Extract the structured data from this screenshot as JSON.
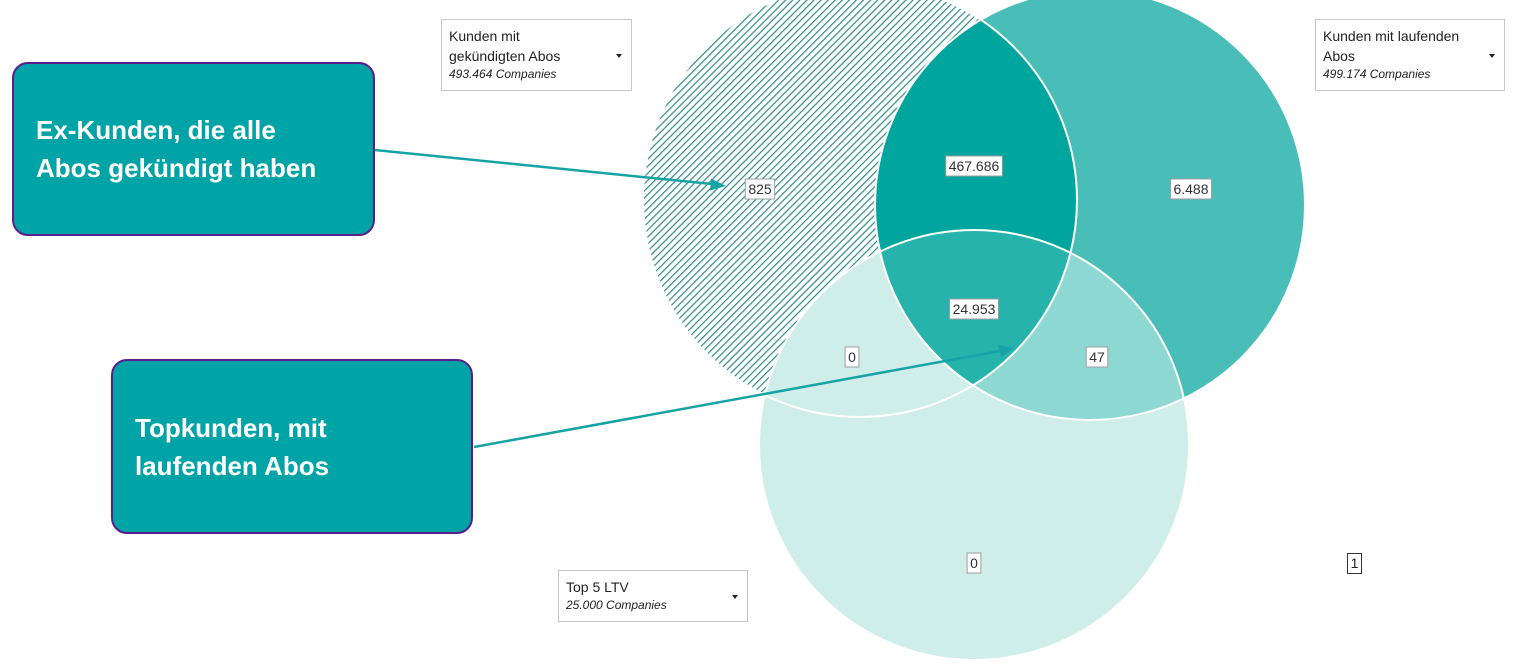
{
  "colors": {
    "set_a": "#49beb8",
    "set_b": "#49beb8",
    "set_c": "#cfede9",
    "ab": "#00a59e",
    "bc": "#8ed8d3",
    "abc": "#26b3ac",
    "ac": "#cfede9",
    "hatch_bg": "#ffffff",
    "hatch_line": "#2f8c85",
    "callout_fill": "#00a3a6",
    "callout_border": "#5a1e8c",
    "arrow": "#16a3a6"
  },
  "sets": [
    {
      "id": "a",
      "title": "Kunden mit gekündigten Abos",
      "title_lines": [
        "Kunden mit",
        "gekündigten Abos"
      ],
      "count": "493.464 Companies"
    },
    {
      "id": "b",
      "title": "Kunden mit laufenden Abos",
      "title_lines": [
        "Kunden mit laufenden",
        "Abos"
      ],
      "count": "499.174 Companies"
    },
    {
      "id": "c",
      "title": "Top 5 LTV",
      "title_lines": [
        "Top 5 LTV"
      ],
      "count": "25.000 Companies"
    }
  ],
  "regions": {
    "a_only": "825",
    "b_only": "6.488",
    "c_only": "0",
    "ab": "467.686",
    "ac": "0",
    "bc": "47",
    "abc": "24.953"
  },
  "callouts": {
    "ex_kunden": {
      "lines": [
        "Ex-Kunden, die alle",
        "Abos gekündigt haben"
      ]
    },
    "topkunden": {
      "lines": [
        "Topkunden, mit",
        "laufenden Abos"
      ]
    }
  },
  "page_indicator": "1"
}
